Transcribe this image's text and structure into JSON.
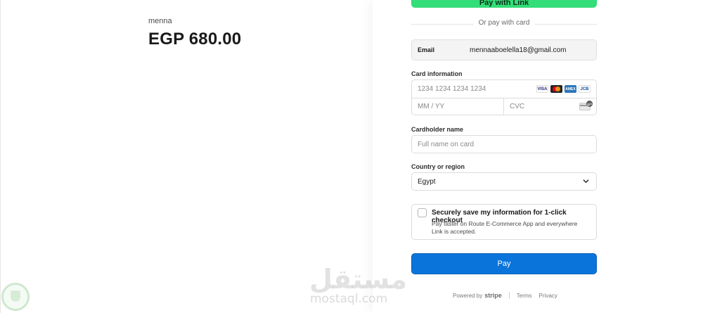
{
  "summary": {
    "merchant": "menna",
    "amount": "EGP 680.00"
  },
  "link_button": {
    "label": "Pay with Link"
  },
  "divider": {
    "text": "Or pay with card"
  },
  "email": {
    "label": "Email",
    "value": "mennaaboelella18@gmail.com"
  },
  "card": {
    "label": "Card information",
    "number_placeholder": "1234 1234 1234 1234",
    "expiry_placeholder": "MM / YY",
    "cvc_placeholder": "CVC",
    "brands": [
      "VISA",
      "Mastercard",
      "AMEX",
      "JCB"
    ]
  },
  "cardholder": {
    "label": "Cardholder name",
    "placeholder": "Full name on card"
  },
  "country": {
    "label": "Country or region",
    "value": "Egypt"
  },
  "save_info": {
    "title": "Securely save my information for 1-click checkout",
    "description": "Pay faster on Route E-Commerce App and everywhere Link is accepted."
  },
  "pay_button": {
    "label": "Pay"
  },
  "footer": {
    "powered_by": "Powered by",
    "brand": "stripe",
    "terms": "Terms",
    "privacy": "Privacy"
  },
  "watermark": {
    "arabic": "مستقل",
    "latin": "mostaql.com"
  },
  "colors": {
    "pay": "#0a74da",
    "link": "#33dd78"
  },
  "icons": [
    "visa-icon",
    "mastercard-icon",
    "amex-icon",
    "jcb-icon",
    "cvc-card-icon",
    "chevron-down-icon",
    "mostaql-badge-icon"
  ]
}
